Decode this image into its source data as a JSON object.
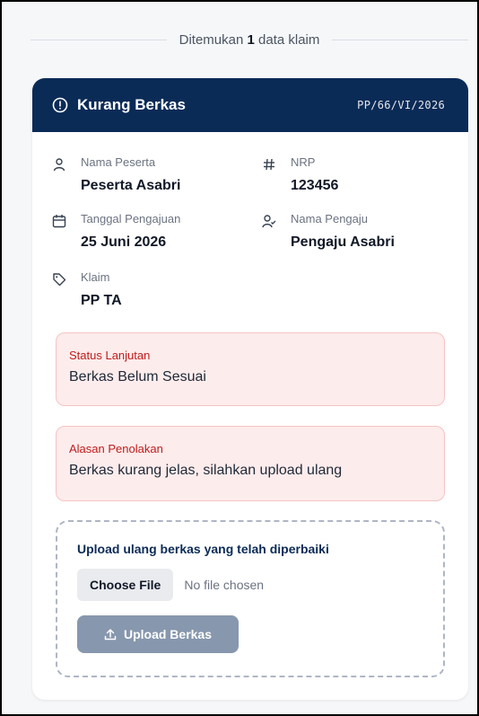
{
  "summary": {
    "prefix": "Ditemukan",
    "count": "1",
    "suffix": "data klaim"
  },
  "card": {
    "status_title": "Kurang Berkas",
    "claim_code": "PP/66/VI/2026",
    "colors": {
      "header_bg": "#0b2b57",
      "alert_bg": "#fdecec",
      "alert_label": "#c01c1c",
      "upload_button_bg": "#8797ad"
    },
    "fields": {
      "participant_name": {
        "label": "Nama Peserta",
        "value": "Peserta Asabri",
        "icon": "user-icon"
      },
      "nrp": {
        "label": "NRP",
        "value": "123456",
        "icon": "hash-icon"
      },
      "submission_date": {
        "label": "Tanggal Pengajuan",
        "value": "25 Juni 2026",
        "icon": "calendar-icon"
      },
      "submitter_name": {
        "label": "Nama Pengaju",
        "value": "Pengaju Asabri",
        "icon": "user-check-icon"
      },
      "claim": {
        "label": "Klaim",
        "value": "PP TA",
        "icon": "tag-icon"
      }
    },
    "followup_status": {
      "label": "Status Lanjutan",
      "text": "Berkas Belum Sesuai"
    },
    "rejection_reason": {
      "label": "Alasan Penolakan",
      "text": "Berkas kurang jelas, silahkan upload ulang"
    },
    "upload": {
      "title": "Upload ulang berkas yang telah diperbaiki",
      "choose_file_label": "Choose File",
      "file_status": "No file chosen",
      "button_label": "Upload Berkas",
      "button_icon": "upload-icon"
    }
  }
}
